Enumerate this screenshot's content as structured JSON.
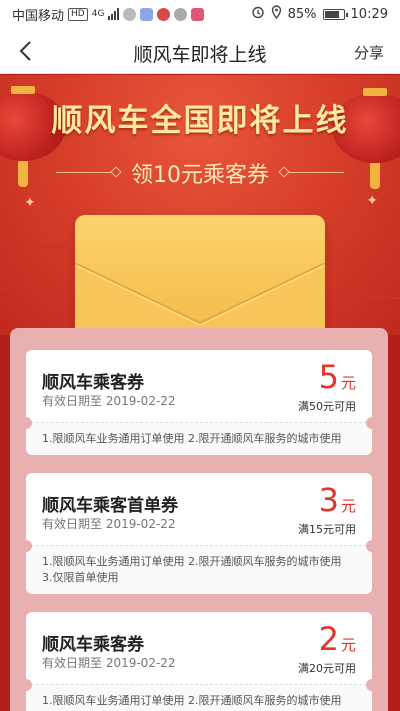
{
  "status_bar": {
    "carrier": "中国移动",
    "network_badge": "HD",
    "network_type": "4G",
    "battery_percent": "85%",
    "battery_level": 0.85,
    "time": "10:29",
    "icons": [
      "signal-icon",
      "message-icon",
      "app-icon",
      "app-icon",
      "app-icon",
      "alarm-icon",
      "location-icon",
      "battery-icon"
    ]
  },
  "nav": {
    "back_icon": "chevron-left-icon",
    "title": "顺风车即将上线",
    "share_label": "分享"
  },
  "banner": {
    "headline": "顺风车全国即将上线",
    "subheadline": "领10元乘客券",
    "colors": {
      "background": "#d8402b",
      "headline": "#ffeaa0",
      "envelope": "#f4b948"
    }
  },
  "coupons": [
    {
      "name": "顺风车乘客券",
      "validity": "有效日期至 2019-02-22",
      "amount": "5",
      "unit": "元",
      "condition": "满50元可用",
      "rules": [
        "1.限顺风车业务通用订单使用 2.限开通顺风车服务的城市使用"
      ]
    },
    {
      "name": "顺风车乘客首单券",
      "validity": "有效日期至 2019-02-22",
      "amount": "3",
      "unit": "元",
      "condition": "满15元可用",
      "rules": [
        "1.限顺风车业务通用订单使用 2.限开通顺风车服务的城市使用",
        "3.仅限首单使用"
      ]
    },
    {
      "name": "顺风车乘客券",
      "validity": "有效日期至 2019-02-22",
      "amount": "2",
      "unit": "元",
      "condition": "满20元可用",
      "rules": [
        "1.限顺风车业务通用订单使用 2.限开通顺风车服务的城市使用"
      ]
    }
  ],
  "accent_color": "#e7332a"
}
